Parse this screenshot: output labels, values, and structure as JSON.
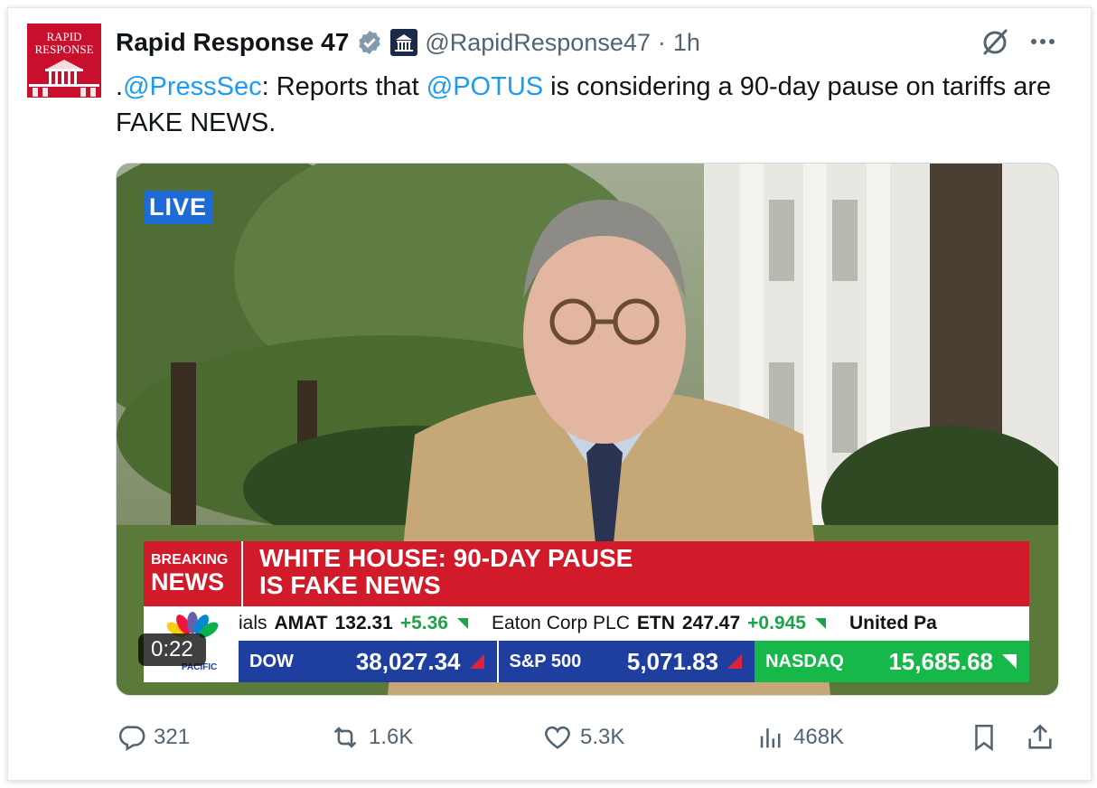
{
  "tweet": {
    "avatar": {
      "line1": "RAPID",
      "line2": "RESPONSE"
    },
    "author_name": "Rapid Response 47",
    "handle": "@RapidResponse47",
    "separator": "·",
    "time": "1h",
    "text": {
      "prefix": ".",
      "mention1": "@PressSec",
      "part1": ": Reports that ",
      "mention2": "@POTUS",
      "part2": " is considering a 90-day pause on tariffs are FAKE NEWS."
    },
    "video": {
      "live_badge": "LIVE",
      "breaking1": "BREAKING",
      "breaking2": "NEWS",
      "headline1": "WHITE HOUSE: 90-DAY PAUSE",
      "headline2": "IS FAKE NEWS",
      "ticker": {
        "t1": "ials",
        "t2": "AMAT",
        "t3": "132.31",
        "t4": "+5.36",
        "t5": "Eaton Corp PLC",
        "t6": "ETN",
        "t7": "247.47",
        "t8": "+0.945",
        "t9": "United Pa"
      },
      "indices": [
        {
          "name": "DOW",
          "value": "38,027.34"
        },
        {
          "name": "S&P 500",
          "value": "5,071.83"
        },
        {
          "name": "NASDAQ",
          "value": "15,685.68"
        }
      ],
      "network_sub": "PACIFIC",
      "duration": "0:22"
    },
    "actions": {
      "replies": "321",
      "reposts": "1.6K",
      "likes": "5.3K",
      "views": "468K"
    }
  },
  "colors": {
    "mention": "#1d9bf0",
    "verified": "#829aab",
    "breaking_red": "#d11a2a",
    "dow_blue": "#1f3fa0",
    "nasdaq_green": "#17b84a"
  }
}
